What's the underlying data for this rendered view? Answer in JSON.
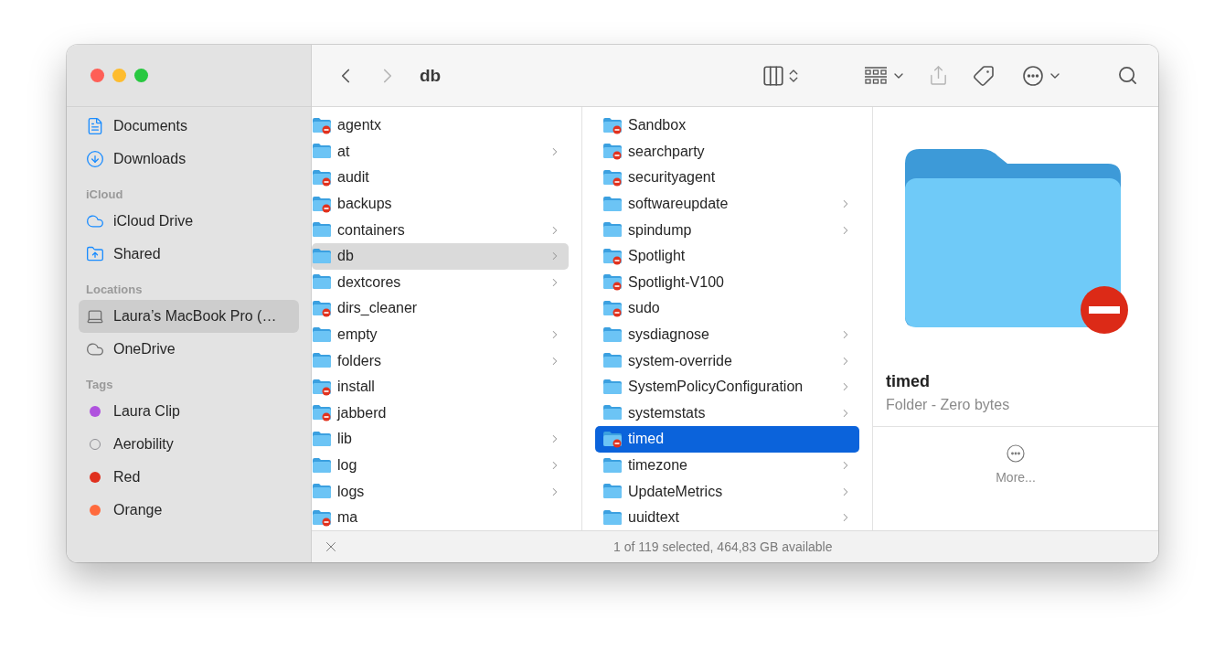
{
  "window": {
    "controls": [
      {
        "color": "#fe5f57"
      },
      {
        "color": "#febc2e"
      },
      {
        "color": "#28c840"
      }
    ]
  },
  "toolbar": {
    "title": "db",
    "back_disabled": false,
    "forward_disabled": true,
    "share_disabled": true
  },
  "sidebar": {
    "sections": [
      {
        "items": [
          {
            "label": "Documents",
            "selected": false
          },
          {
            "label": "Downloads",
            "selected": false
          }
        ]
      },
      {
        "header": "iCloud",
        "items": [
          {
            "label": "iCloud Drive",
            "selected": false
          },
          {
            "label": "Shared",
            "selected": false
          }
        ]
      },
      {
        "header": "Locations",
        "items": [
          {
            "label": "Laura’s MacBook Pro (…",
            "selected": true
          },
          {
            "label": "OneDrive",
            "selected": false
          }
        ]
      },
      {
        "header": "Tags",
        "kind": "tags",
        "items": [
          {
            "label": "Laura Clip",
            "selected": false,
            "color": "#af52de",
            "kind": "filled"
          },
          {
            "label": "Aerobility",
            "selected": false,
            "color": "#8e8e93",
            "kind": "outline"
          },
          {
            "label": "Red",
            "selected": false,
            "color": "#e0301e",
            "kind": "filled"
          },
          {
            "label": "Orange",
            "selected": false,
            "color": "#ff6a3d",
            "kind": "filled"
          }
        ]
      }
    ]
  },
  "columns": [
    {
      "active": false,
      "items": [
        {
          "name": "agentx",
          "locked": true,
          "has_children": false,
          "selected": false
        },
        {
          "name": "at",
          "locked": false,
          "has_children": true,
          "selected": false
        },
        {
          "name": "audit",
          "locked": true,
          "has_children": false,
          "selected": false
        },
        {
          "name": "backups",
          "locked": true,
          "has_children": false,
          "selected": false
        },
        {
          "name": "containers",
          "locked": false,
          "has_children": true,
          "selected": false
        },
        {
          "name": "db",
          "locked": false,
          "has_children": true,
          "selected": true
        },
        {
          "name": "dextcores",
          "locked": false,
          "has_children": true,
          "selected": false
        },
        {
          "name": "dirs_cleaner",
          "locked": true,
          "has_children": false,
          "selected": false
        },
        {
          "name": "empty",
          "locked": false,
          "has_children": true,
          "selected": false
        },
        {
          "name": "folders",
          "locked": false,
          "has_children": true,
          "selected": false
        },
        {
          "name": "install",
          "locked": true,
          "has_children": false,
          "selected": false
        },
        {
          "name": "jabberd",
          "locked": true,
          "has_children": false,
          "selected": false
        },
        {
          "name": "lib",
          "locked": false,
          "has_children": true,
          "selected": false
        },
        {
          "name": "log",
          "locked": false,
          "has_children": true,
          "selected": false
        },
        {
          "name": "logs",
          "locked": false,
          "has_children": true,
          "selected": false
        },
        {
          "name": "ma",
          "locked": true,
          "has_children": false,
          "selected": false
        }
      ]
    },
    {
      "active": true,
      "items": [
        {
          "name": "Sandbox",
          "locked": true,
          "has_children": false,
          "selected": false
        },
        {
          "name": "searchparty",
          "locked": true,
          "has_children": false,
          "selected": false
        },
        {
          "name": "securityagent",
          "locked": true,
          "has_children": false,
          "selected": false
        },
        {
          "name": "softwareupdate",
          "locked": false,
          "has_children": true,
          "selected": false
        },
        {
          "name": "spindump",
          "locked": false,
          "has_children": true,
          "selected": false
        },
        {
          "name": "Spotlight",
          "locked": true,
          "has_children": false,
          "selected": false
        },
        {
          "name": "Spotlight-V100",
          "locked": true,
          "has_children": false,
          "selected": false
        },
        {
          "name": "sudo",
          "locked": true,
          "has_children": false,
          "selected": false
        },
        {
          "name": "sysdiagnose",
          "locked": false,
          "has_children": true,
          "selected": false
        },
        {
          "name": "system-override",
          "locked": false,
          "has_children": true,
          "selected": false
        },
        {
          "name": "SystemPolicyConfiguration",
          "locked": false,
          "has_children": true,
          "selected": false
        },
        {
          "name": "systemstats",
          "locked": false,
          "has_children": true,
          "selected": false
        },
        {
          "name": "timed",
          "locked": true,
          "has_children": false,
          "selected": true
        },
        {
          "name": "timezone",
          "locked": false,
          "has_children": true,
          "selected": false
        },
        {
          "name": "UpdateMetrics",
          "locked": false,
          "has_children": true,
          "selected": false
        },
        {
          "name": "uuidtext",
          "locked": false,
          "has_children": true,
          "selected": false
        }
      ]
    }
  ],
  "preview": {
    "name": "timed",
    "info": "Folder - Zero bytes",
    "locked": true,
    "more_label": "More..."
  },
  "status_bar": {
    "text": "1 of 119 selected, 464,83 GB available"
  }
}
